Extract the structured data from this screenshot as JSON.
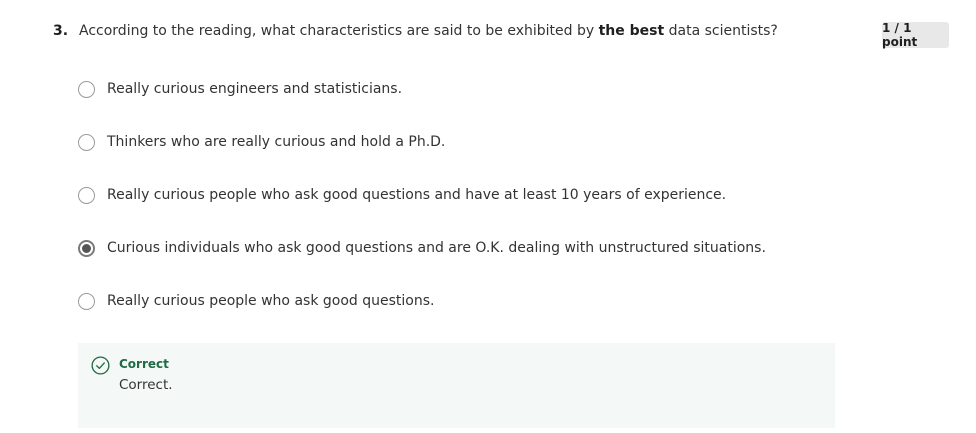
{
  "question": {
    "number": "3.",
    "text_before": "According to the reading, what characteristics are said to be exhibited by ",
    "text_bold": "the best",
    "text_after": " data scientists?",
    "points": "1 / 1 point"
  },
  "options": [
    {
      "label": "Really curious engineers and statisticians.",
      "selected": false
    },
    {
      "label": "Thinkers who are really curious and hold a Ph.D.",
      "selected": false
    },
    {
      "label": "Really curious people who ask good questions and have at least 10 years of experience.",
      "selected": false
    },
    {
      "label": "Curious individuals who ask good questions and are O.K. dealing with unstructured situations.",
      "selected": true
    },
    {
      "label": "Really curious people who ask good questions.",
      "selected": false
    }
  ],
  "feedback": {
    "title": "Correct",
    "text": "Correct.",
    "icon": "check-circle-icon",
    "color": "#1f6b45",
    "background": "#f4f8f6"
  }
}
